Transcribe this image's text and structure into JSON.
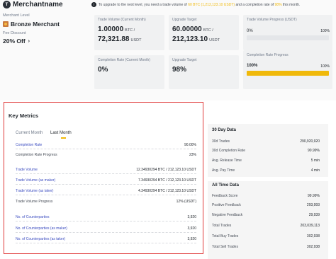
{
  "merchant": {
    "name": "Merchantname",
    "avatar_letter": "T",
    "level_label": "Merchant Level",
    "level_value": "Bronze Merchant",
    "fee_label": "Fee Discount",
    "fee_value": "20% Off"
  },
  "notice": {
    "prefix": "To upgrade to the next level, you need a trade volume of ",
    "volume": "60 BTC (1,212,123.10 USDT)",
    "middle": " and a completion rate of ",
    "rate": "98%",
    "suffix": " this month."
  },
  "cards": {
    "trade_volume": {
      "label": "Trade Volume (Current Month)",
      "btc": "1.00000",
      "btc_unit": "BTC /",
      "usdt": "72,321.88",
      "usdt_unit": "USDT"
    },
    "upgrade_volume": {
      "label": "Upgrade Target",
      "btc": "60.00000",
      "btc_unit": "BTC /",
      "usdt": "212,123.10",
      "usdt_unit": "USDT"
    },
    "volume_progress": {
      "label": "Trade Volume Progress (USDT)",
      "min": "0%",
      "max": "100%",
      "progress": 0
    },
    "completion_rate": {
      "label": "Completion Rate (Current Month)",
      "value": "0%"
    },
    "upgrade_rate": {
      "label": "Upgrade Target",
      "value": "98%"
    },
    "rate_progress": {
      "label": "Completion Rate Progress",
      "value": "100%",
      "max": "100%",
      "progress": 1.0
    }
  },
  "key_metrics": {
    "title": "Key Metrics",
    "tabs": [
      {
        "label": "Current Month"
      },
      {
        "label": "Last Month"
      }
    ],
    "active_tab": "Last Month",
    "rows": [
      {
        "label": "Completion Rate",
        "value": "90.00%",
        "link": true
      },
      {
        "label": "Completion Rate Progress",
        "value": "23%",
        "link": false
      },
      {
        "label": "Trade Volume",
        "value": "12.34930294 BTC / 212,123.10 USDT",
        "link": true
      },
      {
        "label": "Trade Volume (as maker)",
        "value": "7.34930294 BTC / 212,123.10 USDT",
        "link": true
      },
      {
        "label": "Trade Volume (as taker)",
        "value": "4.34930294 BTC / 212,123.10 USDT",
        "link": true
      },
      {
        "label": "Trade Volume Progress",
        "value": "12% (USDT)",
        "link": false
      },
      {
        "label": "No. of Counterparties",
        "value": "3,920",
        "link": true
      },
      {
        "label": "No. of Counterparties (as maker)",
        "value": "3,920",
        "link": true
      },
      {
        "label": "No. of Counterparties (as taker)",
        "value": "3,920",
        "link": true
      }
    ]
  },
  "stats_30d": {
    "title": "30 Day Data",
    "rows": [
      {
        "label": "30d Trades",
        "value": "290,920,920"
      },
      {
        "label": "30d Completion Rate",
        "value": "90.99%"
      },
      {
        "label": "Avg. Release Time",
        "value": "5 min"
      },
      {
        "label": "Avg. Pay Time",
        "value": "4 min"
      }
    ]
  },
  "stats_all": {
    "title": "All Time Data",
    "rows": [
      {
        "label": "Feedback Score",
        "value": "99.99%"
      },
      {
        "label": "Positive Feedback",
        "value": "293,993"
      },
      {
        "label": "Negative Feedback",
        "value": "29,939"
      },
      {
        "label": "Total Trades",
        "value": "203,039,113"
      },
      {
        "label": "Total Buy Trades",
        "value": "302,938"
      },
      {
        "label": "Total Sell Trades",
        "value": "302,938"
      }
    ]
  },
  "colors": {
    "accent": "#f0b90b",
    "highlight_border": "#e03a3a",
    "link": "#3b4cc0"
  },
  "icons": {
    "avatar": "avatar",
    "level": "bronze-medal-icon",
    "fee": "chevron-down-icon",
    "notice": "info-icon"
  }
}
